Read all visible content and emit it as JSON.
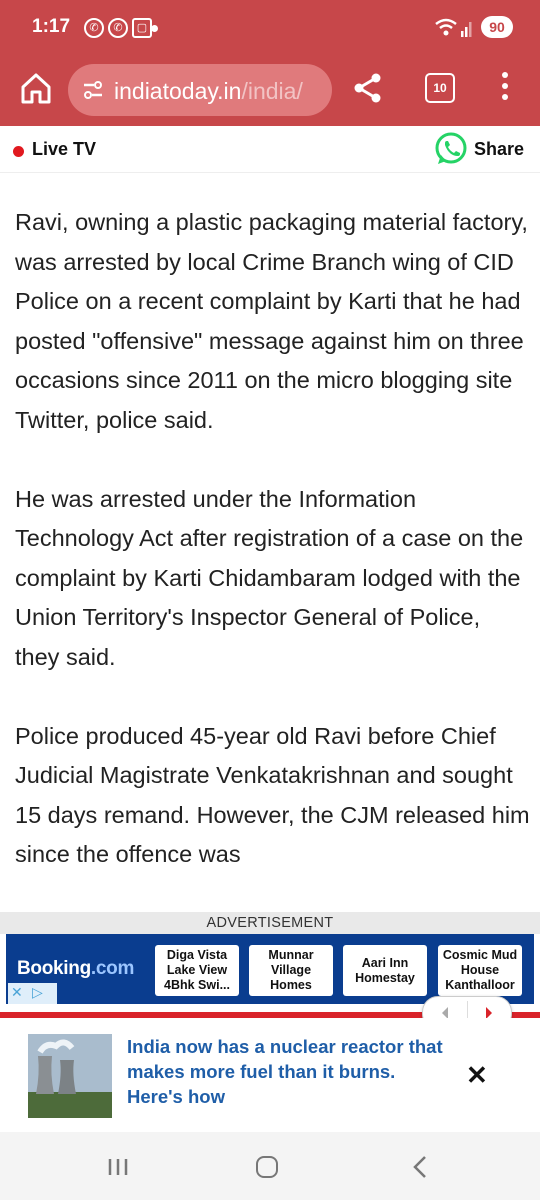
{
  "status_bar": {
    "time": "1:17",
    "battery": "90"
  },
  "browser": {
    "url_domain": "indiatoday.in",
    "url_path": "/india/",
    "tab_count": "10"
  },
  "topbar": {
    "live_label": "Live TV",
    "share_label": "Share"
  },
  "article": {
    "paragraphs": [
      "Ravi, owning a plastic packaging material factory, was arrested by local Crime Branch wing of CID Police on a recent complaint by Karti that he had posted \"offensive\" message against him on three occasions since 2011 on the micro blogging site Twitter, police said.",
      "He was arrested under the Information Technology Act after registration of a case on the complaint by Karti Chidambaram lodged with the Union Territory's Inspector General of Police, they said.",
      "Police produced 45-year old Ravi before Chief Judicial Magistrate Venkatakrishnan and sought 15 days remand. However, the CJM released him since the offence was"
    ]
  },
  "ad": {
    "label": "ADVERTISEMENT",
    "brand": "Booking",
    "brand_suffix": ".com",
    "hotels": [
      "Diga Vista Lake View 4Bhk Swi...",
      "Munnar Village Homes",
      "Aari Inn Homestay",
      "Cosmic Mud House Kanthalloor"
    ]
  },
  "news_card": {
    "title": "India now has a nuclear reactor that makes more fuel than it burns. Here's how"
  },
  "colors": {
    "browser_red": "#c7474a",
    "accent_red": "#d9232a",
    "link_blue": "#1f5ea8",
    "ad_blue": "#0a3d8f"
  },
  "icons": [
    "home-icon",
    "tune-icon",
    "share-icon",
    "tabs-icon",
    "more-icon",
    "whatsapp-icon",
    "close-icon",
    "chevron-left-icon",
    "chevron-right-icon"
  ]
}
